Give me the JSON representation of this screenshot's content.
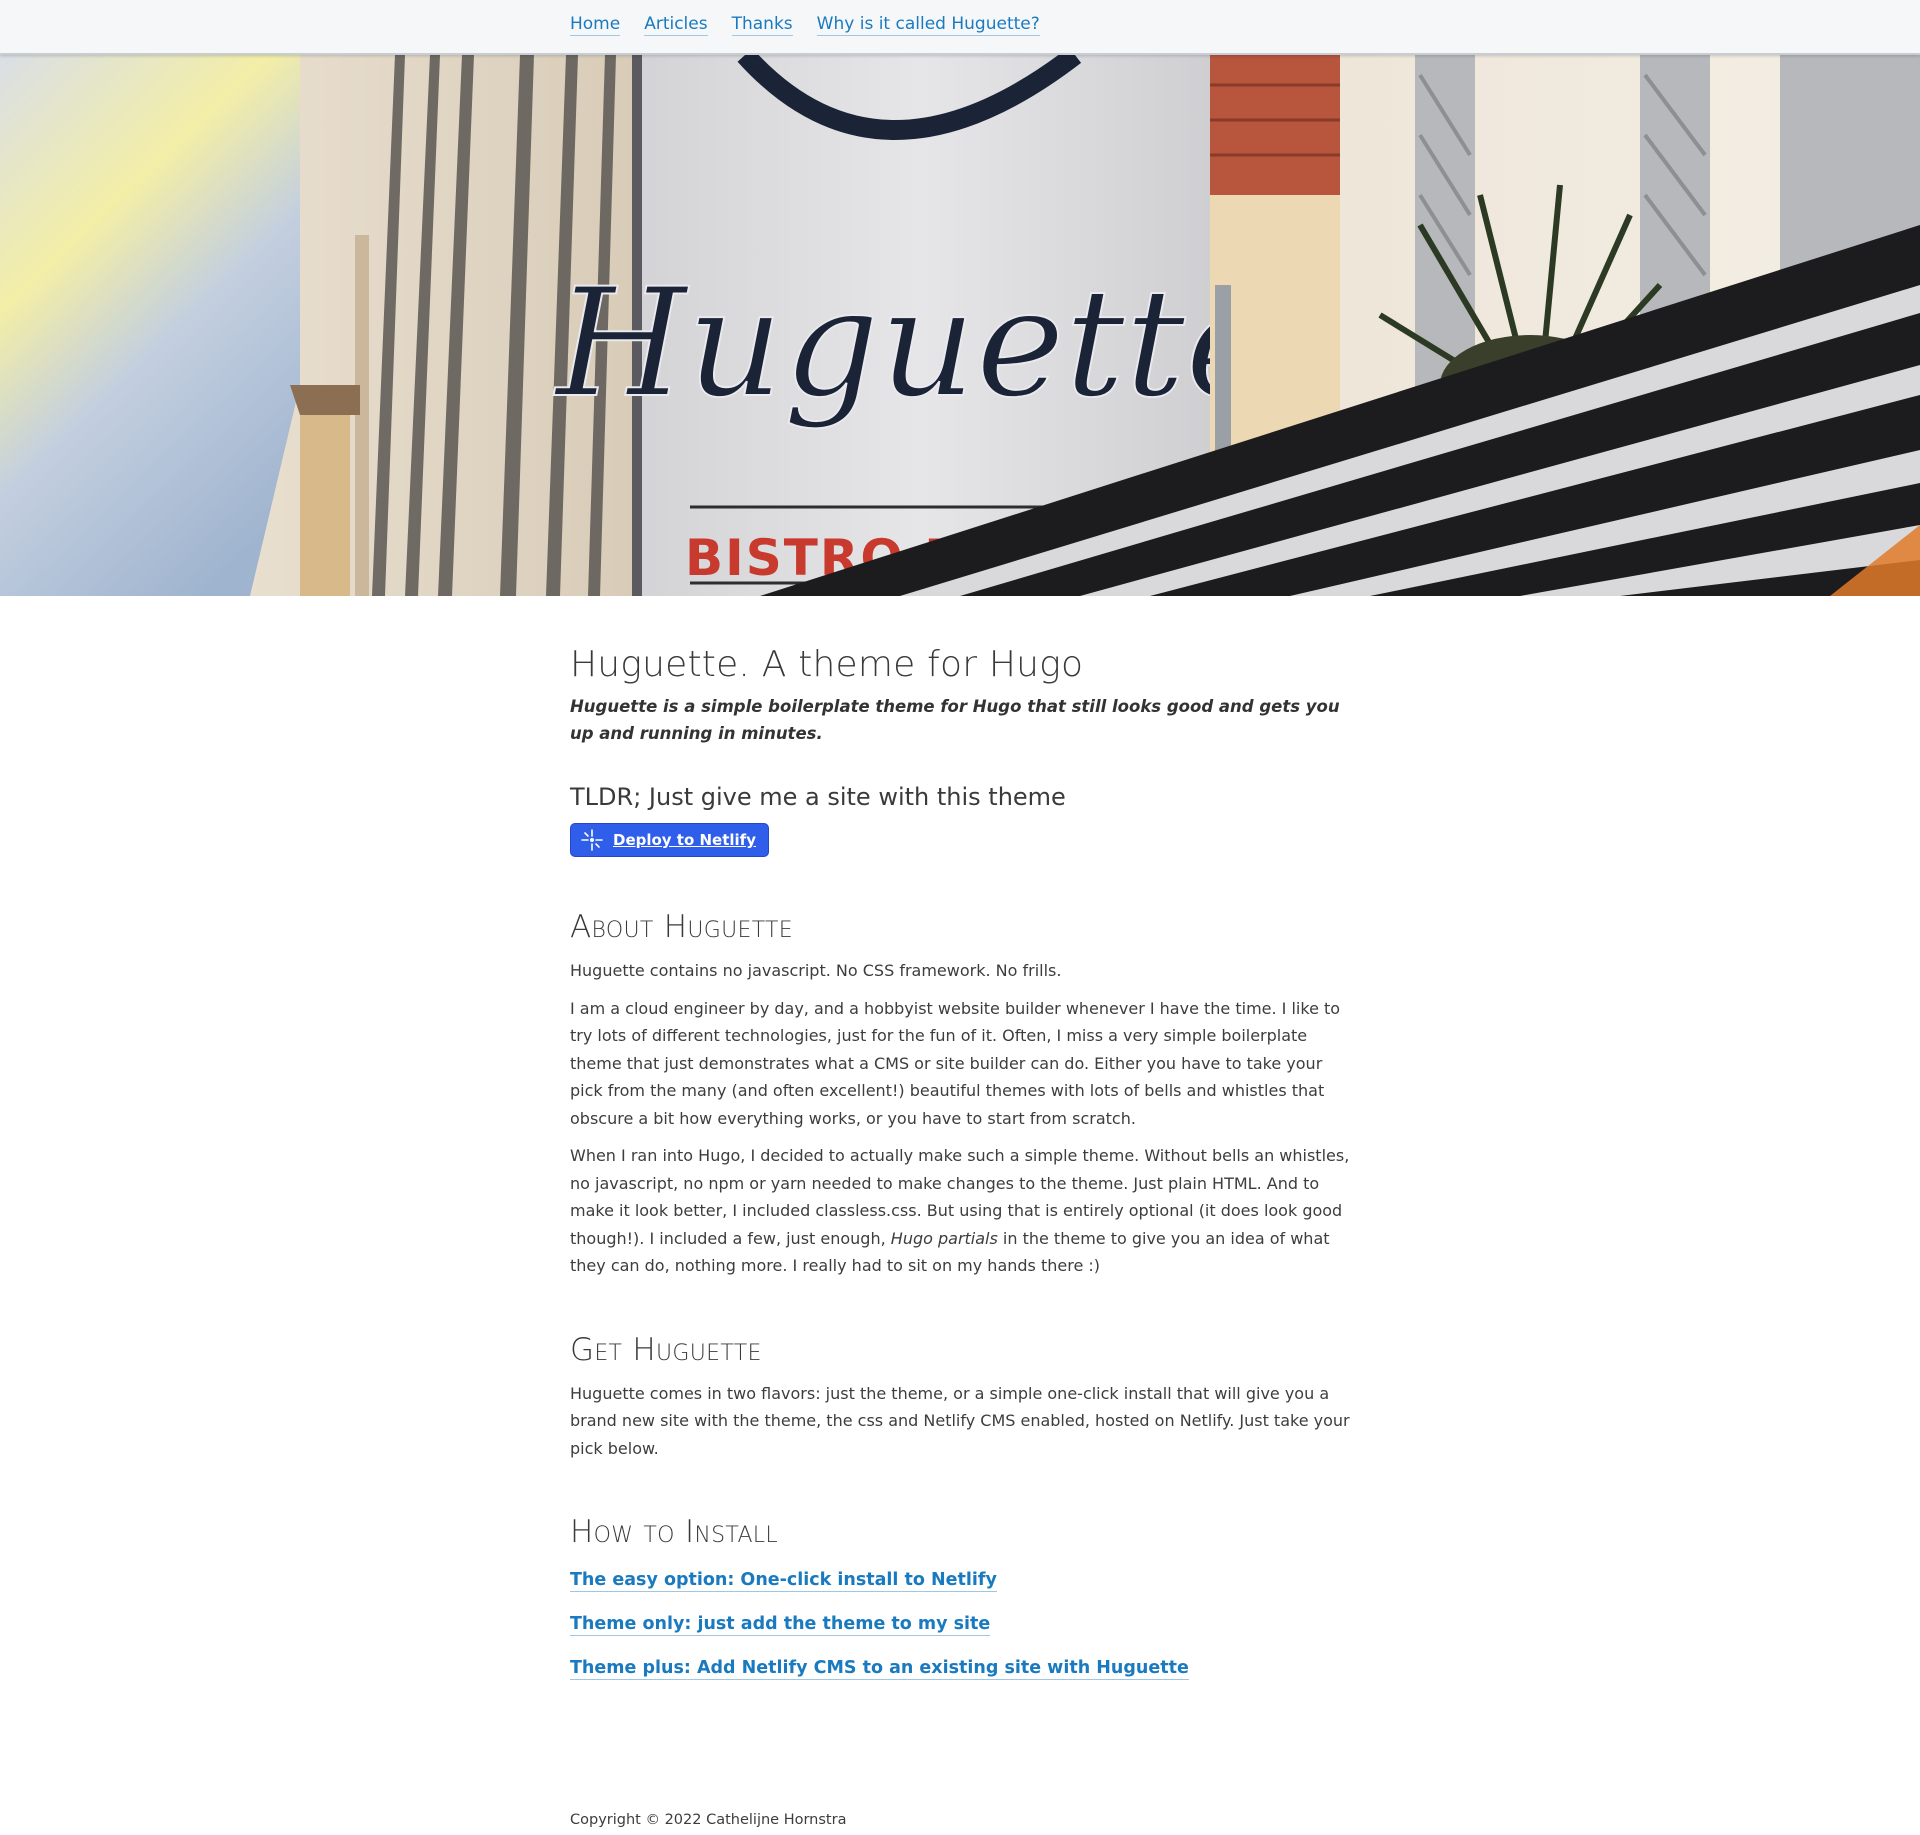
{
  "nav": {
    "items": [
      {
        "label": "Home"
      },
      {
        "label": "Articles"
      },
      {
        "label": "Thanks"
      },
      {
        "label": "Why is it called Huguette?"
      }
    ]
  },
  "hero": {
    "sign_script": "Huguette",
    "sign_subtitle": "BISTRO DE"
  },
  "main": {
    "title": "Huguette. A theme for Hugo",
    "lead": "Huguette is a simple boilerplate theme for Hugo that still looks good and gets you up and running in minutes.",
    "tldr": "TLDR; Just give me a site with this theme",
    "deploy_button": "Deploy to Netlify",
    "about": {
      "heading": "About Huguette",
      "p1": "Huguette contains no javascript. No CSS framework. No frills.",
      "p2": "I am a cloud engineer by day, and a hobbyist website builder whenever I have the time. I like to try lots of different technologies, just for the fun of it. Often, I miss a very simple boilerplate theme that just demonstrates what a CMS or site builder can do. Either you have to take your pick from the many (and often excellent!) beautiful themes with lots of bells and whistles that obscure a bit how everything works, or you have to start from scratch.",
      "p3_before": "When I ran into Hugo, I decided to actually make such a simple theme. Without bells an whistles, no javascript, no npm or yarn needed to make changes to the theme. Just plain HTML. And to make it look better, I included classless.css. But using that is entirely optional (it does look good though!). I included a few, just enough, ",
      "p3_em": "Hugo partials",
      "p3_after": " in the theme to give you an idea of what they can do, nothing more. I really had to sit on my hands there :)"
    },
    "get": {
      "heading": "Get Huguette",
      "p1": "Huguette comes in two flavors: just the theme, or a simple one-click install that will give you a brand new site with the theme, the css and Netlify CMS enabled, hosted on Netlify. Just take your pick below."
    },
    "install": {
      "heading": "How to Install",
      "links": [
        {
          "label": "The easy option: One-click install to Netlify"
        },
        {
          "label": "Theme only: just add the theme to my site"
        },
        {
          "label": "Theme plus: Add Netlify CMS to an existing site with Huguette"
        }
      ]
    }
  },
  "footer": {
    "copyright": "Copyright © 2022 Cathelijne Hornstra"
  },
  "colors": {
    "link": "#1a7ac0",
    "nav_bg": "#f5f7f9",
    "button_bg": "#2f5fea",
    "sign_text": "#1b2436",
    "sign_red": "#c8392e"
  }
}
